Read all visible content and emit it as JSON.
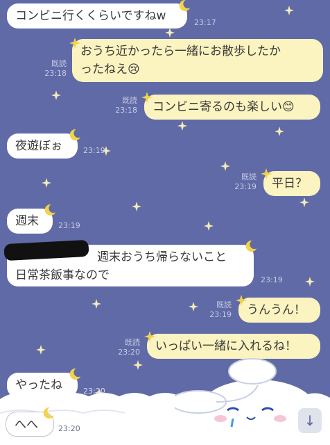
{
  "messages": [
    {
      "text": "コンビニ行くくらいですねw",
      "time": "23:17"
    },
    {
      "line1": "おうち近かったら一緒にお散歩したか",
      "line2": "ったねえ😢",
      "read": "既読",
      "time": "23:18"
    },
    {
      "text": "コンビニ寄るのも楽しい😊",
      "read": "既読",
      "time": "23:18"
    },
    {
      "text": "夜遊ぼぉ",
      "time": "23:19"
    },
    {
      "text": "平日？",
      "read": "既読",
      "time": "23:19"
    },
    {
      "text": "週末",
      "time": "23:19"
    },
    {
      "line1": "週末おうち帰らないこと",
      "line2": "日常茶飯事なので",
      "time": "23:19"
    },
    {
      "text": "うんうん！",
      "read": "既読",
      "time": "23:19"
    },
    {
      "text": "いっぱい一緒に入れるね！",
      "read": "既読",
      "time": "23:20"
    },
    {
      "text": "やったね",
      "time": "23:20"
    },
    {
      "text": "へへ",
      "time": "23:20"
    }
  ],
  "scroll_button": {
    "icon": "arrow-down-icon",
    "glyph": "↓"
  },
  "colors": {
    "background": "#5f6aa6",
    "incoming": "#ffffff",
    "outgoing": "#fbf3c0",
    "moon": "#f3d34a"
  }
}
